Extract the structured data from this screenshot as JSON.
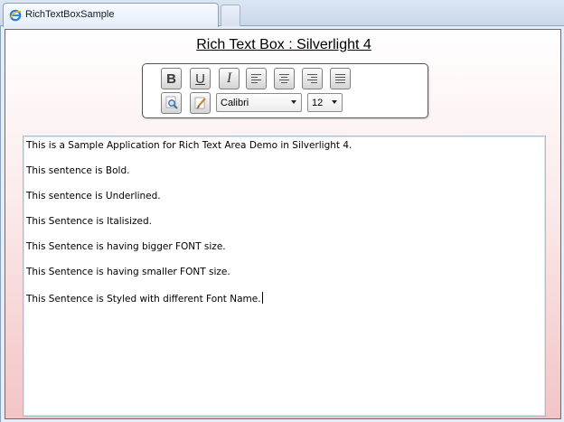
{
  "browser": {
    "tab_title": "RichTextBoxSample",
    "tab_icon": "ie-page-icon",
    "new_tab_icon": "new-tab-icon"
  },
  "app": {
    "title": "Rich Text Box : Silverlight 4"
  },
  "toolbar": {
    "buttons": [
      {
        "name": "bold-button",
        "icon": "bold-icon",
        "glyph": "B"
      },
      {
        "name": "underline-button",
        "icon": "underline-icon",
        "glyph": "U"
      },
      {
        "name": "italic-button",
        "icon": "italic-icon",
        "glyph": "I"
      },
      {
        "name": "align-left-button",
        "icon": "align-left-icon"
      },
      {
        "name": "align-center-button",
        "icon": "align-center-icon"
      },
      {
        "name": "align-right-button",
        "icon": "align-right-icon"
      },
      {
        "name": "align-justify-button",
        "icon": "align-justify-icon"
      },
      {
        "name": "zoom-button",
        "icon": "magnifier-icon"
      },
      {
        "name": "style-button",
        "icon": "paint-brush-icon"
      }
    ],
    "font_family": "Calibri",
    "font_size": "12"
  },
  "editor": {
    "lines": [
      "This is a Sample Application for Rich Text Area Demo in Silverlight 4.",
      "This sentence is Bold.",
      "This sentence is Underlined.",
      "This Sentence is Italisized.",
      "This Sentence is having bigger FONT size.",
      "This Sentence is having smaller FONT size.",
      "This Sentence is Styled with different Font Name."
    ]
  }
}
